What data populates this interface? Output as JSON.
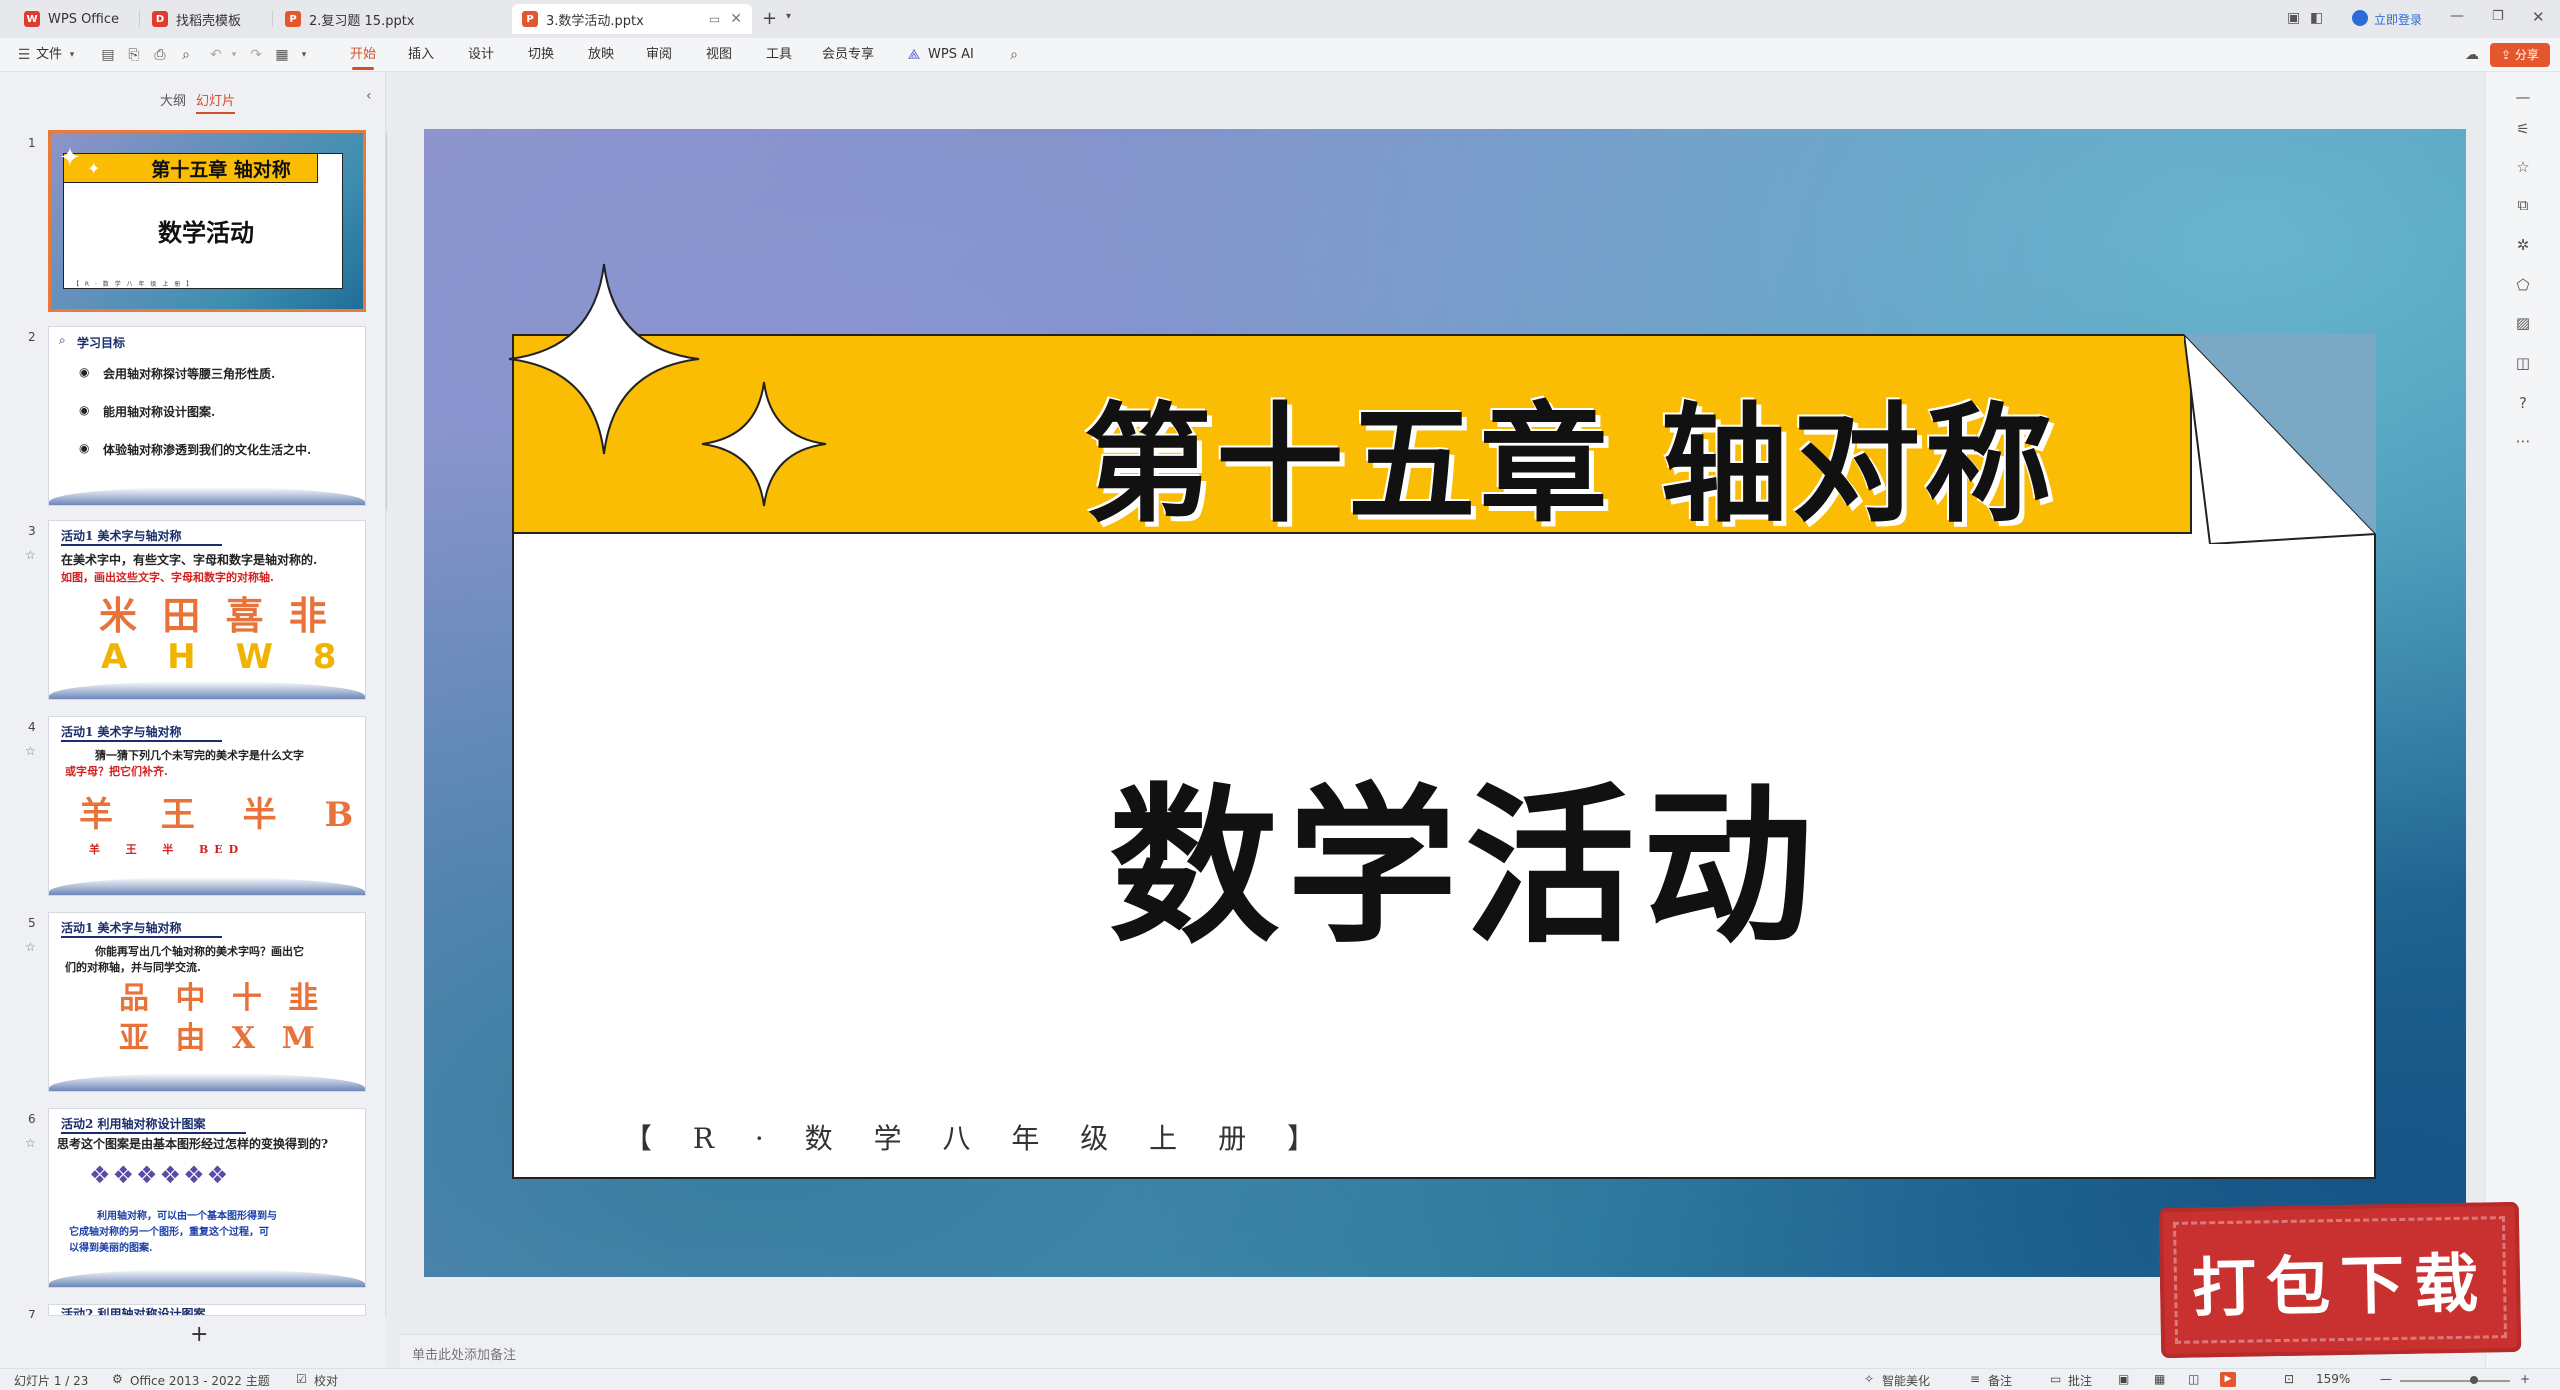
{
  "tabs": [
    {
      "label": "WPS Office",
      "color": "#e03b2f"
    },
    {
      "label": "找稻壳模板",
      "color": "#e03b2f"
    },
    {
      "label": "2.复习题 15.pptx",
      "color": "#e4572e"
    },
    {
      "label": "3.数学活动.pptx",
      "color": "#e4572e"
    }
  ],
  "account": {
    "login_label": "立即登录"
  },
  "menu": {
    "file": "文件",
    "items": [
      "开始",
      "插入",
      "设计",
      "切换",
      "放映",
      "审阅",
      "视图",
      "工具",
      "会员专享",
      "WPS AI"
    ],
    "share": "分享"
  },
  "panel": {
    "tab_outline": "大纲",
    "tab_slides": "幻灯片"
  },
  "thumbnails": [
    {
      "num": "1",
      "chapter": "第十五章 轴对称",
      "title": "数学活动",
      "footer": "【 R · 数 学 八 年 级 上 册 】"
    },
    {
      "num": "2",
      "heading": "学习目标",
      "lines": [
        "会用轴对称探讨等腰三角形性质.",
        "能用轴对称设计图案.",
        "体验轴对称渗透到我们的文化生活之中."
      ]
    },
    {
      "num": "3",
      "heading": "活动1 美术字与轴对称",
      "lines": [
        "在美术字中，有些文字、字母和数字是轴对称的.",
        "如图，画出这些文字、字母和数字的对称轴."
      ],
      "glyphs1": "米 田 喜 非",
      "glyphs2": "A H W 8"
    },
    {
      "num": "4",
      "heading": "活动1 美术字与轴对称",
      "lines": [
        "猜一猜下列几个未写完的美术字是什么文字",
        "或字母？把它们补齐."
      ],
      "glyphs1": "羊 王 半 BED",
      "glyphs2": "羊  王  半  BED"
    },
    {
      "num": "5",
      "heading": "活动1 美术字与轴对称",
      "lines": [
        "你能再写出几个轴对称的美术字吗？画出它",
        "们的对称轴，并与同学交流."
      ],
      "glyphs1": "品 中 十 韭",
      "glyphs2": "亚 由 X M"
    },
    {
      "num": "6",
      "heading": "活动2 利用轴对称设计图案",
      "lines": [
        "思考这个图案是由基本图形经过怎样的变换得到的?",
        "利用轴对称，可以由一个基本图形得到与",
        "它成轴对称的另一个图形，重复这个过程，可",
        "以得到美丽的图案."
      ]
    },
    {
      "num": "7",
      "heading": "活动2 利用轴对称设计图案"
    }
  ],
  "slide": {
    "chapter": "第十五章 轴对称",
    "title": "数学活动",
    "footer": "【 R · 数 学 八 年 级 上 册 】"
  },
  "notes_placeholder": "单击此处添加备注",
  "status": {
    "slide_counter": "幻灯片 1 / 23",
    "theme": "Office 2013 - 2022 主题",
    "proof": "校对",
    "beautify": "智能美化",
    "notes": "备注",
    "comments": "批注",
    "zoom": "159%"
  },
  "stamp_text": "打包下载"
}
